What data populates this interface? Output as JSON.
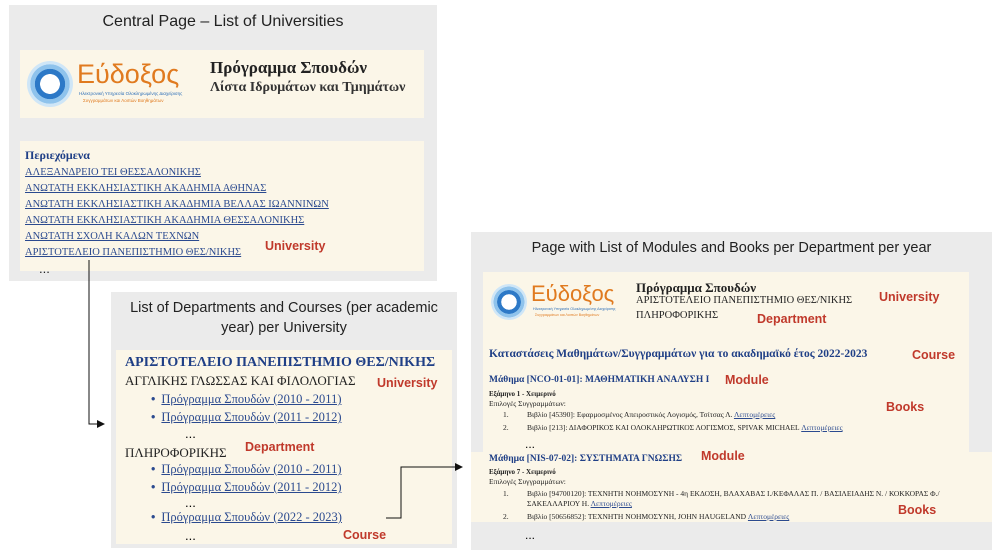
{
  "panel1": {
    "title": "Central Page – List of Universities",
    "header_title": "Πρόγραμμα Σπουδών",
    "header_subtitle": "Λίστα Ιδρυμάτων και Τμημάτων",
    "contents_label": "Περιεχόμενα",
    "universities": [
      "ΑΛΕΞΑΝΔΡΕΙΟ ΤΕΙ ΘΕΣΣΑΛΟΝΙΚΗΣ",
      "ΑΝΩΤΑΤΗ ΕΚΚΛΗΣΙΑΣΤΙΚΗ ΑΚΑΔΗΜΙΑ ΑΘΗΝΑΣ",
      "ΑΝΩΤΑΤΗ ΕΚΚΛΗΣΙΑΣΤΙΚΗ ΑΚΑΔΗΜΙΑ ΒΕΛΛΑΣ ΙΩΑΝΝΙΝΩΝ",
      "ΑΝΩΤΑΤΗ ΕΚΚΛΗΣΙΑΣΤΙΚΗ ΑΚΑΔΗΜΙΑ ΘΕΣΣΑΛΟΝΙΚΗΣ",
      "ΑΝΩΤΑΤΗ ΣΧΟΛΗ ΚΑΛΩΝ ΤΕΧΝΩΝ",
      "ΑΡΙΣΤΟΤΕΛΕΙΟ ΠΑΝΕΠΙΣΤΗΜΙΟ ΘΕΣ/ΝΙΚΗΣ"
    ],
    "ellipsis": "...",
    "tag_university": "University"
  },
  "logo": {
    "word": "Εύδοξος",
    "line1": "Ηλεκτρονική Υπηρεσία Ολοκληρωμένης Διαχείρισης",
    "line2": "Συγγραμμάτων και Λοιπών Βοηθημάτων"
  },
  "panel2": {
    "title_line1": "List of Departments and Courses (per academic",
    "title_line2": "year) per University",
    "university_name": "ΑΡΙΣΤΟΤΕΛΕΙΟ ΠΑΝΕΠΙΣΤΗΜΙΟ ΘΕΣ/ΝΙΚΗΣ",
    "dept1": "ΑΓΓΛΙΚΗΣ ΓΛΩΣΣΑΣ ΚΑΙ ΦΙΛΟΛΟΓΙΑΣ",
    "dept1_courses": [
      "Πρόγραμμα Σπουδών (2010 - 2011)",
      "Πρόγραμμα Σπουδών (2011 - 2012)"
    ],
    "dept2": "ΠΛΗΡΟΦΟΡΙΚΗΣ",
    "dept2_courses": [
      "Πρόγραμμα Σπουδών (2010 - 2011)",
      "Πρόγραμμα Σπουδών (2011 - 2012)"
    ],
    "course_selected": "Πρόγραμμα Σπουδών (2022 - 2023)",
    "ellipsis": "...",
    "tag_university": "University",
    "tag_department": "Department",
    "tag_course": "Course"
  },
  "panel3": {
    "title": "Page with List of Modules and Books per Department per year",
    "header_title": "Πρόγραμμα Σπουδών",
    "header_university": "ΑΡΙΣΤΟΤΕΛΕΙΟ ΠΑΝΕΠΙΣΤΗΜΙΟ ΘΕΣ/ΝΙΚΗΣ",
    "header_department": "ΠΛΗΡΟΦΟΡΙΚΗΣ",
    "course_heading": "Καταστάσεις Μαθημάτων/Συγγραμμάτων για το ακαδημαϊκό έτος 2022-2023",
    "module1": {
      "title": "Μάθημα [NCO-01-01]: ΜΑΘΗΜΑΤΙΚΗ ΑΝΑΛΥΣΗ Ι",
      "semester": "Εξάμηνο 1 - Χειμερινό",
      "choices": "Επιλογές Συγγραμμάτων:",
      "books": [
        {
          "num": "1.",
          "text": "Βιβλίο [45390]: Εφαρμοσμένος Απειροστικός Λογισμός, Τσίτσας Λ.",
          "link": "Λεπτομέρειες"
        },
        {
          "num": "2.",
          "text": "Βιβλίο [213]: ΔΙΑΦΟΡΙΚΟΣ ΚΑΙ ΟΛΟΚΛΗΡΩΤΙΚΟΣ ΛΟΓΙΣΜΟΣ, SPIVAK MICHAEL",
          "link": "Λεπτομέρειες"
        }
      ]
    },
    "module2": {
      "title": "Μάθημα [NIS-07-02]: ΣΥΣΤΗΜΑΤΑ ΓΝΩΣΗΣ",
      "semester": "Εξάμηνο 7 - Χειμερινό",
      "choices": "Επιλογές Συγγραμμάτων:",
      "books": [
        {
          "num": "1.",
          "text": "Βιβλίο [94700120]: ΤΕΧΝΗΤΗ ΝΟΗΜΟΣΥΝΗ - 4η ΕΚΔΟΣΗ, ΒΛΑΧΑΒΑΣ Ι./ΚΕΦΑΛΑΣ Π. / ΒΑΣΙΛΕΙΑΔΗΣ Ν. / ΚΟΚΚΟΡΑΣ Φ./",
          "text2": "ΣΑΚΕΛΛΑΡΙΟΥ Η.",
          "link": "Λεπτομέρειες"
        },
        {
          "num": "2.",
          "text": "Βιβλίο [50656852]: ΤΕΧΝΗΤΗ ΝΟΗΜΟΣΥΝΗ, JOHN HAUGELAND",
          "link": "Λεπτομέρειες"
        }
      ]
    },
    "ellipsis": "...",
    "tag_university": "University",
    "tag_department": "Department",
    "tag_course": "Course",
    "tag_module": "Module",
    "tag_books": "Books"
  }
}
